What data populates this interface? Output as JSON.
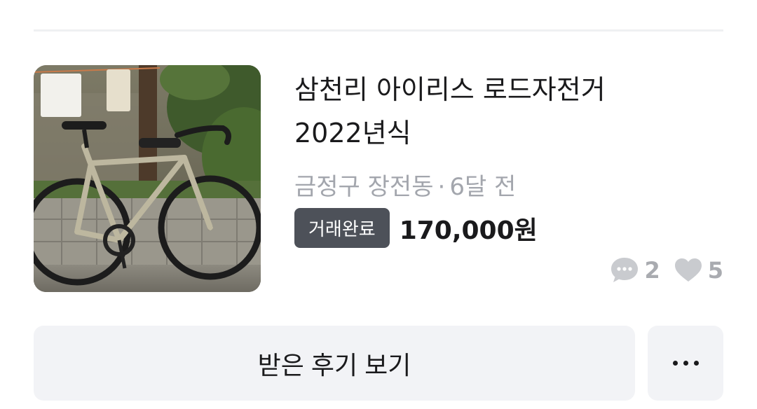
{
  "listing": {
    "title": "삼천리 아이리스 로드자전거 2022년식",
    "location": "금정구 장전동",
    "separator": "·",
    "time_ago": "6달 전",
    "status_badge": "거래완료",
    "price": "170,000원",
    "chat_count": "2",
    "like_count": "5",
    "image_icon": "bicycle-photo"
  },
  "actions": {
    "review_label": "받은 후기 보기",
    "more_icon": "more-horizontal-icon"
  },
  "colors": {
    "badge_bg": "#4d5159",
    "button_bg": "#f2f3f6",
    "meta_text": "#a3a6ad",
    "stat_icon": "#c9cbcf"
  }
}
